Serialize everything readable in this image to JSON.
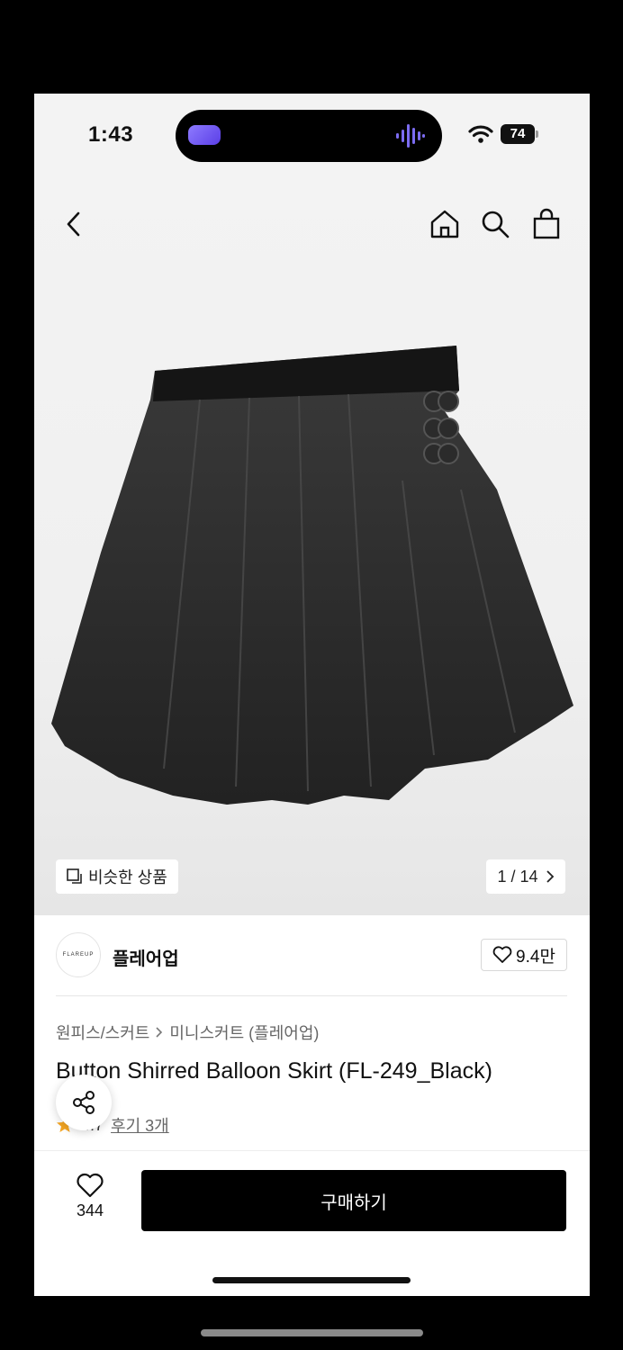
{
  "status_bar": {
    "time": "1:43",
    "battery": "74"
  },
  "nav": {
    "icons": [
      "back-icon",
      "home-icon",
      "search-icon",
      "shopping-bag-icon"
    ]
  },
  "gallery": {
    "similar_label": "비슷한 상품",
    "page_counter": "1 / 14"
  },
  "brand": {
    "logo_text": "FLAREUP",
    "name": "플레어업",
    "likes": "9.4만"
  },
  "product": {
    "category_1": "원피스/스커트",
    "category_2": "미니스커트 (플레어업)",
    "title": "Button Shirred Balloon Skirt (FL-249_Black)",
    "rating": "4.7",
    "reviews": "후기 3개"
  },
  "bottom_bar": {
    "wish_count": "344",
    "buy_label": "구매하기"
  },
  "colors": {
    "buy_button": "#000000",
    "star": "#f5a623",
    "background": "#f3f3f3"
  }
}
